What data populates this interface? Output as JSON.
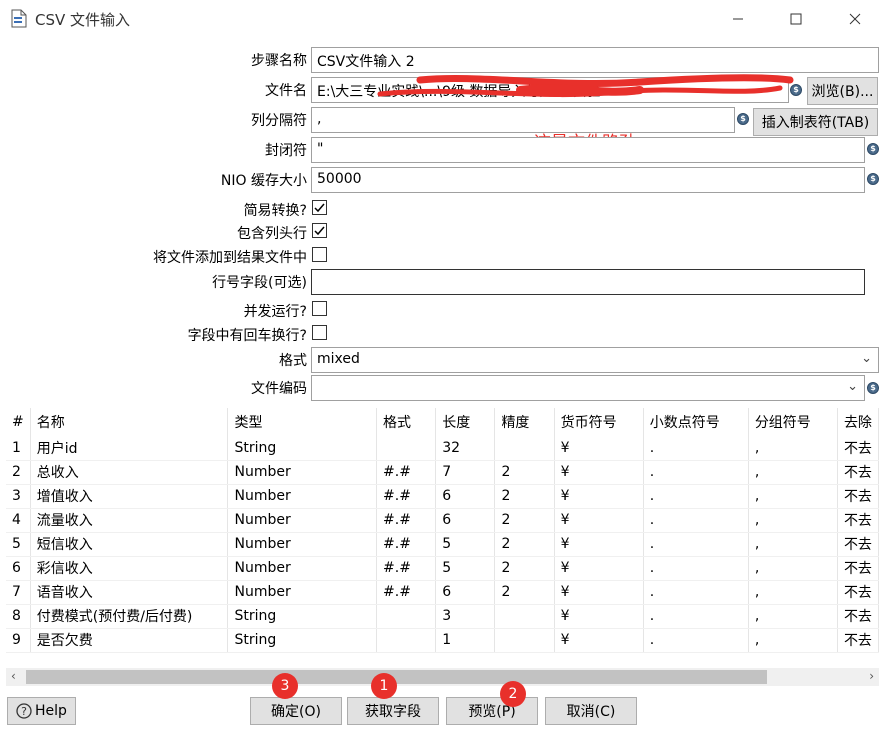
{
  "window": {
    "title": "CSV 文件输入"
  },
  "form": {
    "step_name": {
      "label": "步骤名称",
      "value": "CSV文件输入 2"
    },
    "file_name": {
      "label": "文件名",
      "value": "E:\\大三专业实践\\...\\9级 数据导入与处理-实验",
      "browse": "浏览(B)..."
    },
    "delimiter": {
      "label": "列分隔符",
      "value": ",",
      "insert_tab": "插入制表符(TAB)"
    },
    "enclosure": {
      "label": "封闭符",
      "value": "\""
    },
    "nio_buffer": {
      "label": "NIO 缓存大小",
      "value": "50000"
    },
    "lazy_conversion": {
      "label": "简易转换?",
      "checked": true
    },
    "header_row": {
      "label": "包含列头行",
      "checked": true
    },
    "add_to_result": {
      "label": "将文件添加到结果文件中",
      "checked": false
    },
    "row_number_field": {
      "label": "行号字段(可选)",
      "value": ""
    },
    "parallel": {
      "label": "并发运行?",
      "checked": false
    },
    "newline_in_fields": {
      "label": "字段中有回车换行?",
      "checked": false
    },
    "format": {
      "label": "格式",
      "value": "mixed"
    },
    "encoding": {
      "label": "文件编码",
      "value": ""
    }
  },
  "annotation": "这是文件路劲",
  "table": {
    "headers": [
      "#",
      "名称",
      "类型",
      "格式",
      "长度",
      "精度",
      "货币符号",
      "小数点符号",
      "分组符号",
      "去除"
    ],
    "rows": [
      [
        "1",
        "用户id",
        "String",
        "",
        "32",
        "",
        "¥",
        ".",
        ",",
        "不去"
      ],
      [
        "2",
        "总收入",
        "Number",
        "#.#",
        "7",
        "2",
        "¥",
        ".",
        ",",
        "不去"
      ],
      [
        "3",
        "增值收入",
        "Number",
        "#.#",
        "6",
        "2",
        "¥",
        ".",
        ",",
        "不去"
      ],
      [
        "4",
        "流量收入",
        "Number",
        "#.#",
        "6",
        "2",
        "¥",
        ".",
        ",",
        "不去"
      ],
      [
        "5",
        "短信收入",
        "Number",
        "#.#",
        "5",
        "2",
        "¥",
        ".",
        ",",
        "不去"
      ],
      [
        "6",
        "彩信收入",
        "Number",
        "#.#",
        "5",
        "2",
        "¥",
        ".",
        ",",
        "不去"
      ],
      [
        "7",
        "语音收入",
        "Number",
        "#.#",
        "6",
        "2",
        "¥",
        ".",
        ",",
        "不去"
      ],
      [
        "8",
        "付费模式(预付费/后付费)",
        "String",
        "",
        "3",
        "",
        "¥",
        ".",
        ",",
        "不去"
      ],
      [
        "9",
        "是否欠费",
        "String",
        "",
        "1",
        "",
        "¥",
        ".",
        ",",
        "不去"
      ]
    ]
  },
  "buttons": {
    "help": "Help",
    "ok": "确定(O)",
    "get_fields": "获取字段",
    "preview": "预览(P)",
    "cancel": "取消(C)"
  },
  "badges": {
    "get_fields": "1",
    "preview": "2",
    "ok": "3"
  },
  "colors": {
    "annotation_red": "#e8302b",
    "button_bg": "#e1e1e1"
  }
}
